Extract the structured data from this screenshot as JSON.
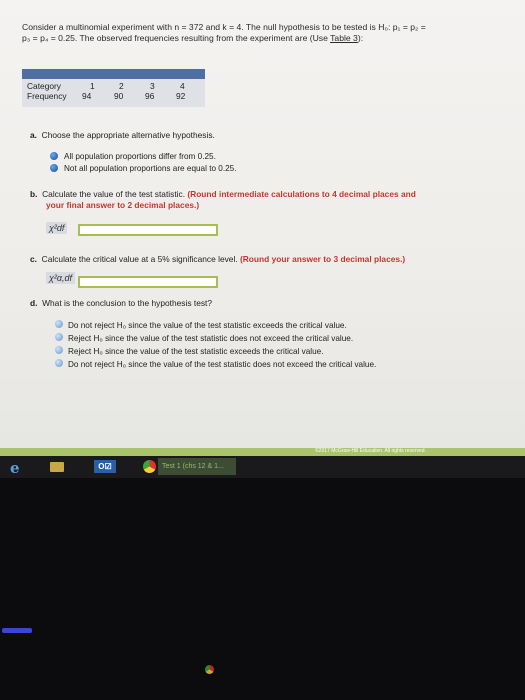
{
  "intro": {
    "line1": "Consider a multinomial experiment with n = 372 and k = 4. The null hypothesis to be tested is H₀: p₁ = p₂ =",
    "line2_pre": "p₃ = p₄ = 0.25. The observed frequencies resulting from the experiment are (Use ",
    "line2_link": "Table 3",
    "line2_post": "):"
  },
  "table": {
    "row1_label": "Category",
    "row2_label": "Frequency",
    "categories": [
      "1",
      "2",
      "3",
      "4"
    ],
    "frequencies": [
      "94",
      "90",
      "96",
      "92"
    ]
  },
  "qa": {
    "prefix": "a.",
    "text": "Choose the appropriate alternative hypothesis.",
    "options": [
      "All population proportions differ from 0.25.",
      "Not all population proportions are equal to 0.25."
    ]
  },
  "qb": {
    "prefix": "b.",
    "text": "Calculate the value of the test statistic.",
    "note1": "(Round intermediate calculations to 4 decimal places and",
    "note2": "your final answer to 2 decimal places.)",
    "symbol": "χ²df"
  },
  "qc": {
    "prefix": "c.",
    "text": "Calculate the critical value at a 5% significance level.",
    "note": "(Round your answer to 3 decimal places.)",
    "symbol": "χ²α,df"
  },
  "qd": {
    "prefix": "d.",
    "text": "What is the conclusion to the hypothesis test?",
    "options": [
      "Do not reject H₀ since the value of the test statistic exceeds the critical value.",
      "Reject H₀ since the value of the test statistic does not exceed the critical value.",
      "Reject H₀ since the value of the test statistic exceeds the critical value.",
      "Do not reject H₀ since the value of the test statistic does not exceed the critical value."
    ]
  },
  "footer": {
    "copyright": "©2017 McGraw-Hill Education. All rights reserved."
  },
  "taskbar": {
    "outlook_label": "O☑",
    "task_label": "Test 1 (chs 12 & 1..."
  }
}
